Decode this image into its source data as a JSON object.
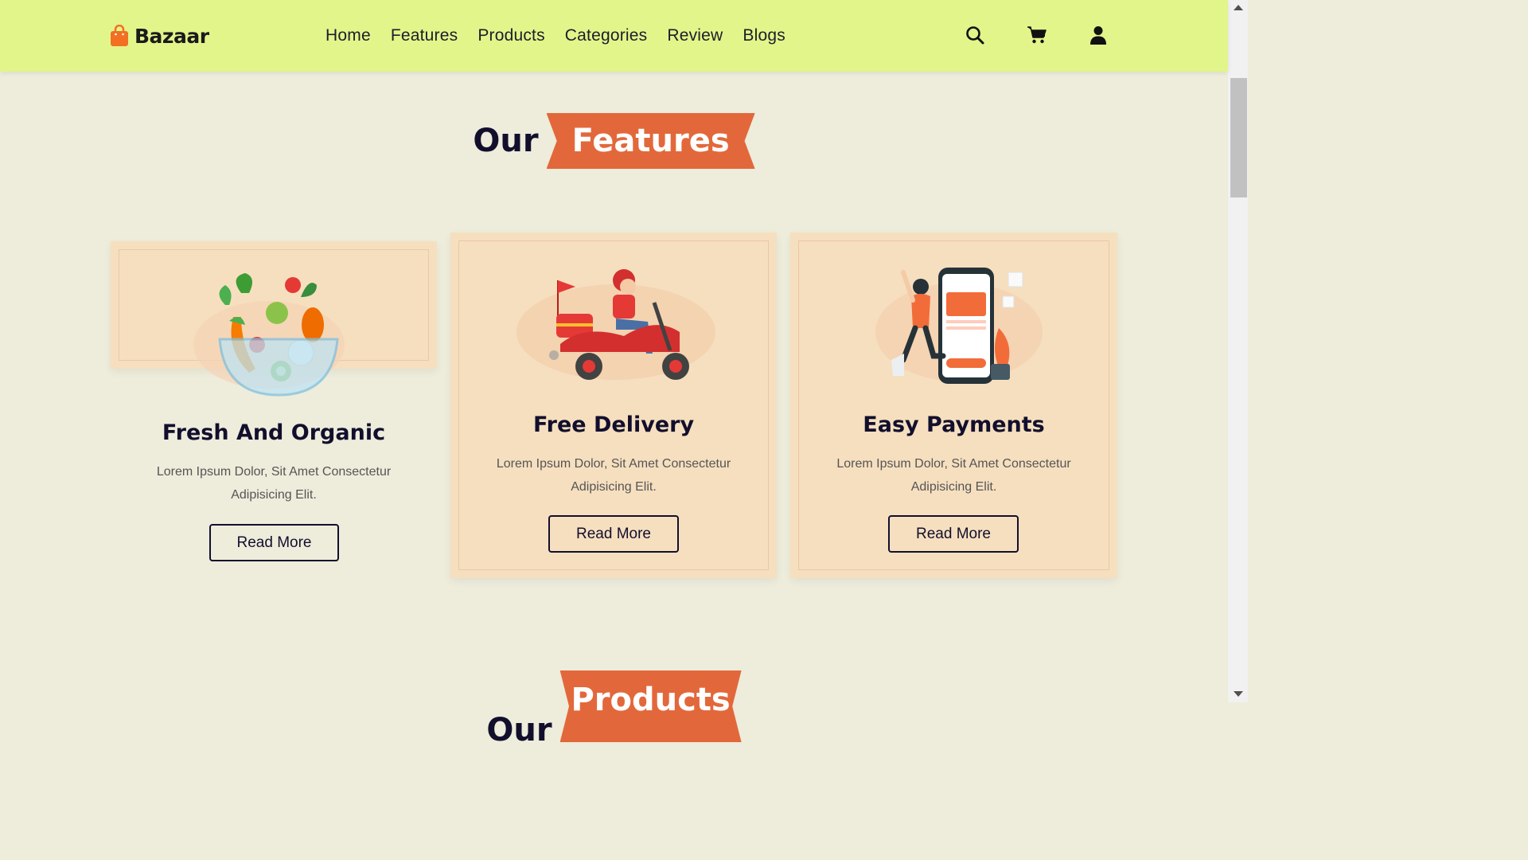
{
  "brand": {
    "name": "Bazaar",
    "accent": "#f36f21"
  },
  "nav": {
    "items": [
      {
        "label": "Home"
      },
      {
        "label": "Features"
      },
      {
        "label": "Products"
      },
      {
        "label": "Categories"
      },
      {
        "label": "Review"
      },
      {
        "label": "Blogs"
      }
    ]
  },
  "header_icons": {
    "search": "search-icon",
    "cart": "cart-icon",
    "user": "user-icon"
  },
  "features_section": {
    "our": "Our",
    "tag": "Features"
  },
  "cards": [
    {
      "title": "Fresh And Organic",
      "desc": "Lorem Ipsum Dolor, Sit Amet Consectetur Adipisicing Elit.",
      "button": "Read More",
      "illustration": "salad-bowl"
    },
    {
      "title": "Free Delivery",
      "desc": "Lorem Ipsum Dolor, Sit Amet Consectetur Adipisicing Elit.",
      "button": "Read More",
      "illustration": "delivery-scooter"
    },
    {
      "title": "Easy Payments",
      "desc": "Lorem Ipsum Dolor, Sit Amet Consectetur Adipisicing Elit.",
      "button": "Read More",
      "illustration": "mobile-payment"
    }
  ],
  "products_section": {
    "our": "Our",
    "tag": "Products"
  },
  "colors": {
    "header_bg": "#e2f58a",
    "page_bg": "#eeecdb",
    "card_bg": "#f6dfbf",
    "tag_bg": "#e2683b",
    "heading_text": "#120f2d"
  }
}
